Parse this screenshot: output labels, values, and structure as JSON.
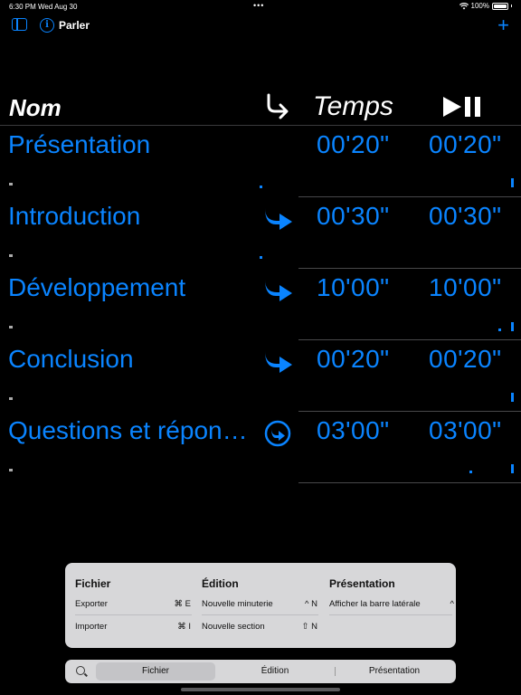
{
  "status": {
    "time": "6:30 PM",
    "date": "Wed Aug 30",
    "dots": "•••",
    "battery": "100%"
  },
  "nav": {
    "title": "Parler",
    "info_glyph": "i",
    "add_glyph": "+"
  },
  "header": {
    "name": "Nom",
    "time": "Temps"
  },
  "rows": [
    {
      "name": "Présentation",
      "icon": "none",
      "time1": "00'20\"",
      "time2": "00'20\""
    },
    {
      "name": "Introduction",
      "icon": "curved-arrow-icon",
      "time1": "00'30\"",
      "time2": "00'30\""
    },
    {
      "name": "Développement",
      "icon": "curved-arrow-icon",
      "time1": "10'00\"",
      "time2": "10'00\""
    },
    {
      "name": "Conclusion",
      "icon": "curved-arrow-icon",
      "time1": "00'20\"",
      "time2": "00'20\""
    },
    {
      "name": "Questions et répon…",
      "icon": "circled-arrow-icon",
      "time1": "03'00\"",
      "time2": "03'00\""
    }
  ],
  "menu": {
    "fichier": {
      "title": "Fichier",
      "items": [
        {
          "label": "Exporter",
          "shortcut": "⌘ E"
        },
        {
          "label": "Importer",
          "shortcut": "⌘ I"
        }
      ]
    },
    "edition": {
      "title": "Édition",
      "items": [
        {
          "label": "Nouvelle minuterie",
          "shortcut": "^ N"
        },
        {
          "label": "Nouvelle section",
          "shortcut": "⇧ N"
        }
      ]
    },
    "presentation": {
      "title": "Présentation",
      "items": [
        {
          "label": "Afficher la barre latérale",
          "shortcut": "^"
        }
      ]
    }
  },
  "tabs": {
    "fichier": "Fichier",
    "edition": "Édition",
    "presentation": "Présentation"
  },
  "colors": {
    "accent": "#0a84ff",
    "background": "#000000",
    "menu_bg": "#d7d7d9"
  }
}
